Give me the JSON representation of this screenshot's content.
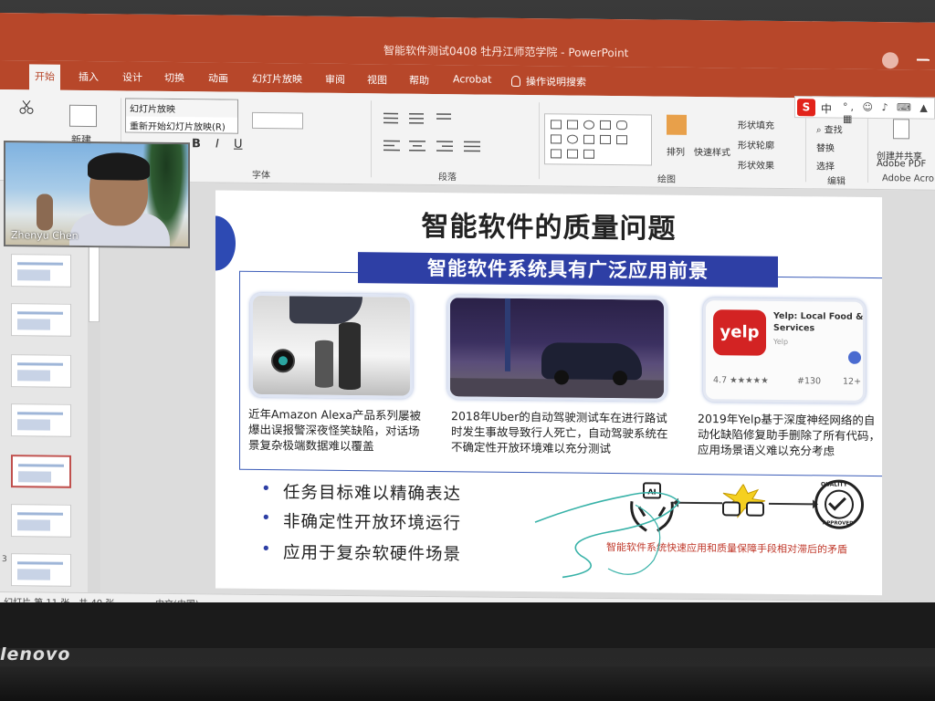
{
  "window": {
    "title": "智能软件测试0408  牡丹江师范学院   -   PowerPoint"
  },
  "ribbon_tabs": [
    "开始",
    "插入",
    "设计",
    "切换",
    "动画",
    "幻灯片放映",
    "审阅",
    "视图",
    "帮助",
    "Acrobat"
  ],
  "tell_me": "操作说明搜索",
  "ime_bar": {
    "logo": "S",
    "mode": "中"
  },
  "dropdown": {
    "items": [
      "幻灯片放映",
      "重新开始幻灯片放映(R)"
    ]
  },
  "ribbon": {
    "groups": {
      "font": "字体",
      "paragraph": "段落",
      "drawing": "绘图",
      "editing": "编辑",
      "adobe": "Adobe Acro"
    },
    "new_slide": "新建",
    "arrange": "排列",
    "quick_styles": "快速样式",
    "shape_fill": "形状填充",
    "shape_outline": "形状轮廓",
    "shape_effects": "形状效果",
    "find": "查找",
    "replace": "替换",
    "select": "选择",
    "create_share_1": "创建并共享",
    "create_share_2": "Adobe PDF"
  },
  "webcam": {
    "name": "Zhenyu Chen"
  },
  "slide_panel_number": "3",
  "slide": {
    "title": "智能软件的质量问题",
    "banner": "智能软件系统具有广泛应用前景",
    "captions": [
      "近年Amazon Alexa产品系列屡被爆出误报警深夜怪笑缺陷，对话场景复杂极端数据难以覆盖",
      "2018年Uber的自动驾驶测试车在进行路试时发生事故导致行人死亡，自动驾驶系统在不确定性开放环境难以充分测试",
      "2019年Yelp基于深度神经网络的自动化缺陷修复助手删除了所有代码，应用场景语义难以充分考虑"
    ],
    "yelp_card": {
      "logo": "yelp",
      "app_name": "Yelp: Local Food & Services",
      "sub": "Yelp",
      "rating": "4.7 ★★★★★",
      "reviews": "#130",
      "age": "12+"
    },
    "bullets": [
      "任务目标难以精确表达",
      "非确定性开放环境运行",
      "应用于复杂软硬件场景"
    ],
    "contradiction": "智能软件系统快速应用和质量保障手段相对滞后的矛盾",
    "ai_label": "AI",
    "badge_top": "QUALITY",
    "badge_bottom": "APPROVED"
  },
  "status": {
    "slide_count": "幻灯片 第 11 张，共 40 张",
    "language": "中文(中国)",
    "notes": "备注",
    "comments": "批注"
  },
  "laptop_brand": "lenovo",
  "colors": {
    "ppt_accent": "#b7472a",
    "banner_blue": "#2e3fa5",
    "contradiction_red": "#c0392b"
  }
}
